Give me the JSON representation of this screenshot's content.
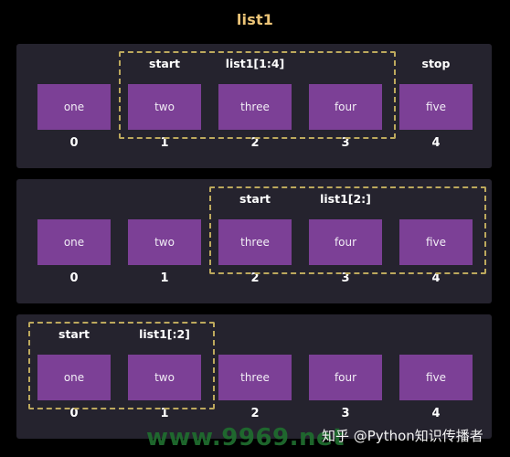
{
  "title": "list1",
  "colors": {
    "page_background": "#000000",
    "panel_background": "#25232e",
    "cell_fill": "#7c4096",
    "slice_border": "#bda95d",
    "title_text": "#ecc477",
    "label_text": "#ffffff"
  },
  "items": [
    "one",
    "two",
    "three",
    "four",
    "five"
  ],
  "indices": [
    "0",
    "1",
    "2",
    "3",
    "4"
  ],
  "rows": [
    {
      "slice_label": "list1[1:4]",
      "start_label": "start",
      "stop_label": "stop",
      "start_index": 1,
      "stop_index": 4,
      "cells": [
        {
          "value": "one",
          "index": "0",
          "marker": ""
        },
        {
          "value": "two",
          "index": "1",
          "marker": "start"
        },
        {
          "value": "three",
          "index": "2",
          "marker": ""
        },
        {
          "value": "four",
          "index": "3",
          "marker": ""
        },
        {
          "value": "five",
          "index": "4",
          "marker": "stop"
        }
      ]
    },
    {
      "slice_label": "list1[2:]",
      "start_label": "start",
      "stop_label": "",
      "start_index": 2,
      "stop_index": 5,
      "cells": [
        {
          "value": "one",
          "index": "0",
          "marker": ""
        },
        {
          "value": "two",
          "index": "1",
          "marker": ""
        },
        {
          "value": "three",
          "index": "2",
          "marker": "start"
        },
        {
          "value": "four",
          "index": "3",
          "marker": ""
        },
        {
          "value": "five",
          "index": "4",
          "marker": ""
        }
      ]
    },
    {
      "slice_label": "list1[:2]",
      "start_label": "start",
      "stop_label": "",
      "start_index": 0,
      "stop_index": 2,
      "cells": [
        {
          "value": "one",
          "index": "0",
          "marker": "start"
        },
        {
          "value": "two",
          "index": "1",
          "marker": ""
        },
        {
          "value": "three",
          "index": "2",
          "marker": ""
        },
        {
          "value": "four",
          "index": "3",
          "marker": ""
        },
        {
          "value": "five",
          "index": "4",
          "marker": ""
        }
      ]
    }
  ],
  "watermarks": {
    "url": "www.9969.net",
    "zhihu": "知乎 @Python知识传播者"
  }
}
